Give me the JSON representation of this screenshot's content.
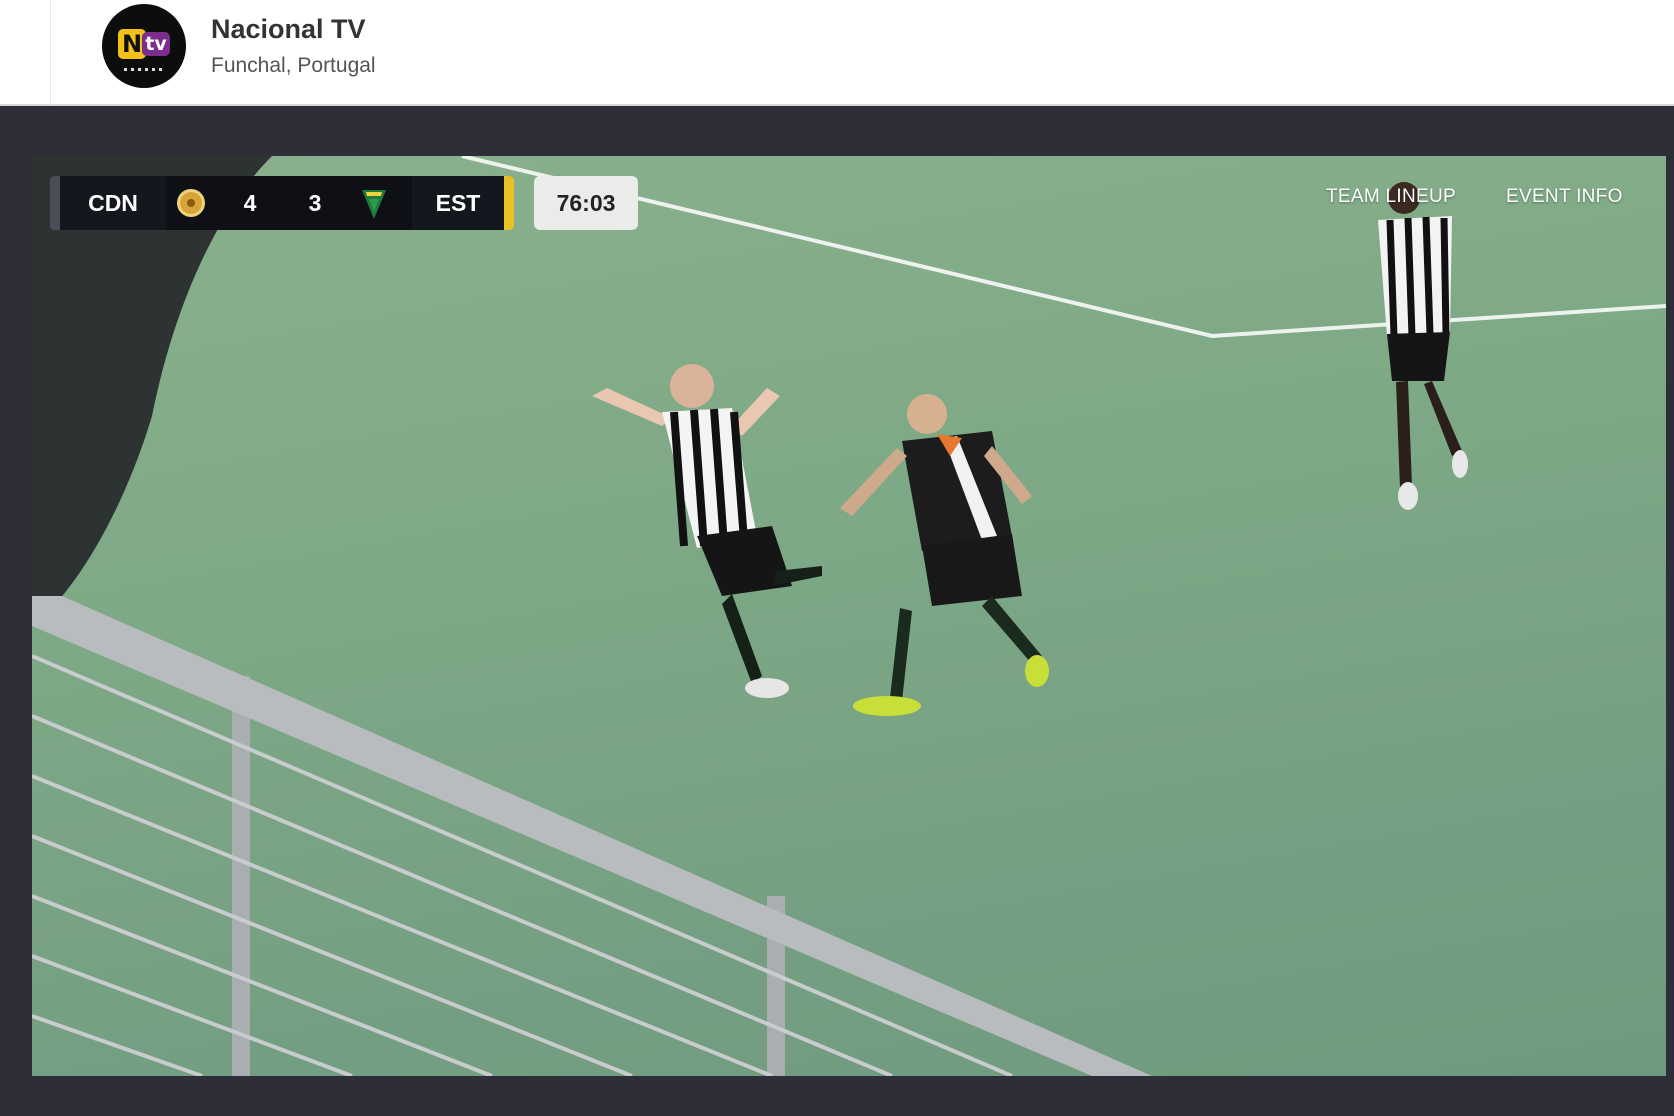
{
  "header": {
    "channel_name": "Nacional TV",
    "location": "Funchal, Portugal",
    "logo": {
      "letter_n": "N",
      "letters_tv": "tv",
      "colors": {
        "n": "#f2c21b",
        "tv": "#7a2d8c"
      }
    }
  },
  "scoreboard": {
    "home_team": "CDN",
    "home_score": "4",
    "away_score": "3",
    "away_team": "EST",
    "clock": "76:03",
    "accent_colors": {
      "home": "#4a4e58",
      "away": "#e8c128"
    }
  },
  "overlay_links": {
    "team_lineup": "TEAM LINEUP",
    "event_info": "EVENT INFO"
  },
  "colors": {
    "page_background": "#2d2e37",
    "pitch": "#7ea986"
  }
}
